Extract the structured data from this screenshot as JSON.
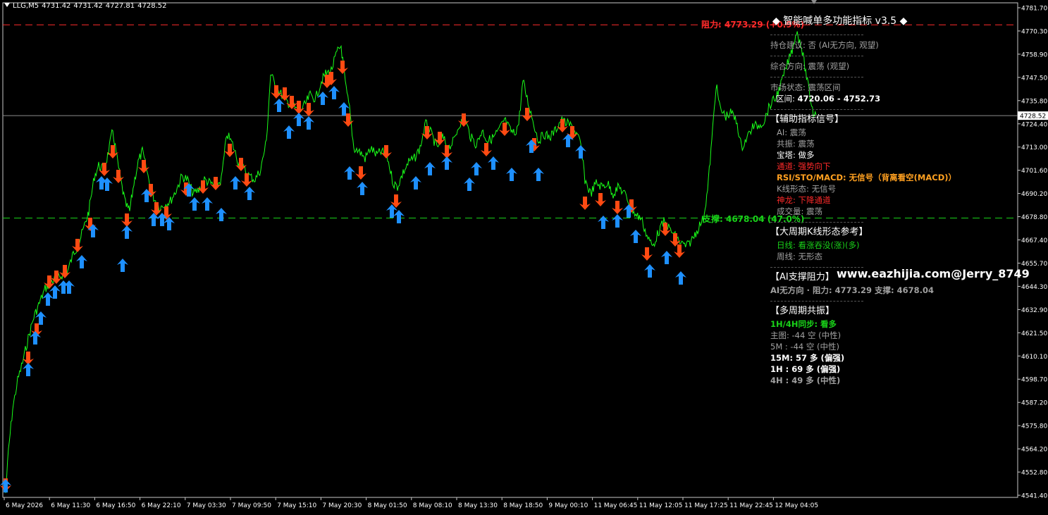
{
  "header": {
    "symbol": "LLG,M5",
    "open": "4731.42",
    "high": "4731.42",
    "low": "4727.81",
    "close": "4728.52"
  },
  "price_axis": {
    "labels": [
      "4781.70",
      "4770.30",
      "4758.90",
      "4747.50",
      "4735.80",
      "4724.40",
      "4713.00",
      "4701.60",
      "4690.20",
      "4678.80",
      "4667.40",
      "4655.70",
      "4644.30",
      "4632.90",
      "4621.50",
      "4610.10",
      "4598.70",
      "4587.20",
      "4575.80",
      "4564.20",
      "4552.80",
      "4541.40"
    ],
    "current_price": "4728.52",
    "top_value": 4781.7,
    "bottom_value": 4541.4
  },
  "time_axis": [
    "6 May 2026",
    "6 May 11:30",
    "6 May 16:50",
    "6 May 22:10",
    "7 May 03:30",
    "7 May 09:50",
    "7 May 15:10",
    "7 May 20:30",
    "8 May 01:50",
    "8 May 08:10",
    "8 May 13:30",
    "8 May 18:50",
    "9 May 00:10",
    "11 May 06:45",
    "11 May 12:05",
    "11 May 17:25",
    "11 May 22:45",
    "12 May 04:05"
  ],
  "levels": {
    "resistance": {
      "value": 4773.29,
      "label": "阻力: 4773.29 (+0.9%)"
    },
    "support": {
      "value": 4678.04,
      "label": "支撑: 4678.04 (47.0%)"
    }
  },
  "panel": {
    "title": "智能喊单多功能指标 v3.5",
    "position_advice": "持仓建议: 否 (AI无方向, 观望)",
    "overall_direction": "综合方向: 震荡 (观望)",
    "market_state": "市场状态: 震荡区间",
    "range_label": "区间:",
    "range_value": "4720.06 - 4752.73",
    "aux_header": "【辅助指标信号】",
    "aux": {
      "ai": "AI: 震荡",
      "resonance": "共振: 震荡",
      "tower": "宝塔: 做多",
      "channel": "通道: 强势向下",
      "rsi": "RSI/STO/MACD: 无信号（背离看空(MACD)）",
      "kline": "K线形态: 无信号",
      "dragon": "神龙: 下降通道",
      "volume": "成交量: 震荡"
    },
    "bigcycle_header": "【大周期K线形态参考】",
    "daily": "日线: 看涨吞没(涨)(多)",
    "weekly": "周线: 无形态",
    "ai_sr_header": "【AI支撑阻力】",
    "ai_sr": "AI无方向 · 阻力: 4773.29   支撑: 4678.04",
    "multi_header": "【多周期共振】",
    "sync": "1H/4H同步: 看多",
    "main": "主图: -44 空 (中性)",
    "m5": "5M : -44 空 (中性)",
    "m15": "15M: 57 多 (偏强)",
    "h1": "1H : 69 多 (偏强)",
    "h4": "4H : 49 多 (中性)"
  },
  "watermark": "www.eazhijia.com@Jerry_8749",
  "colors": {
    "price_line": "#19ff19",
    "buy_arrow": "#1e90ff",
    "sell_arrow": "#ff4a12",
    "resistance": "#ff2a2a",
    "support": "#19d219"
  }
}
